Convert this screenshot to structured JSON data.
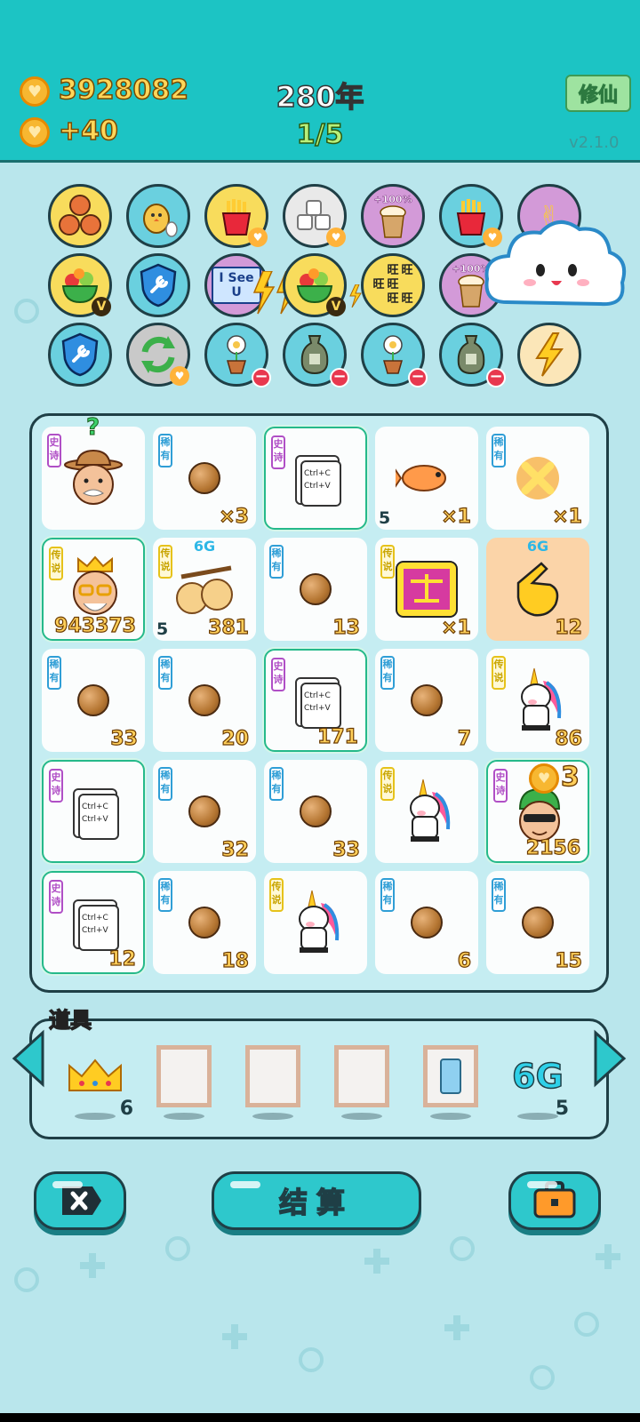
{
  "header": {
    "coins": "3928082",
    "income": "+40",
    "years": "280年",
    "progress": "1/5",
    "xiuxian_button": "修仙",
    "version": "v2.1.0"
  },
  "skills": {
    "row1": [
      "basketballs",
      "chick-egg",
      "fries-heart",
      "marshmallow-heart",
      "bubble-tea-100",
      "fries-heart",
      "rock-hand"
    ],
    "row2": [
      "fruit-bowl-v",
      "shield-wrench",
      "I See U",
      "fruit-bowl-v",
      "旺",
      "bubble-tea-100"
    ],
    "row3": [
      "shield-wrench",
      "refresh-heart",
      "plant-minus",
      "bag-minus",
      "plant-minus",
      "bag-minus",
      "lightning"
    ],
    "bubble_tea_text": "+100%",
    "isee_text": "I See U",
    "wang_text": "旺"
  },
  "grid": [
    {
      "tag": "史诗",
      "tagType": "epic",
      "item": "farmer-head",
      "badge": "?",
      "num": "",
      "left": "",
      "hl": false
    },
    {
      "tag": "稀有",
      "tagType": "rare",
      "item": "ball",
      "num": "×3",
      "left": "",
      "hl": false
    },
    {
      "tag": "史诗",
      "tagType": "epic",
      "item": "ctrl-cv",
      "num": "",
      "left": "",
      "hl": true
    },
    {
      "tag": "",
      "tagType": "",
      "item": "fish",
      "num": "×1",
      "left": "5",
      "hl": false
    },
    {
      "tag": "稀有",
      "tagType": "rare",
      "item": "burst-x",
      "num": "×1",
      "left": "",
      "hl": false
    },
    {
      "tag": "传说",
      "tagType": "legend",
      "item": "king-grandpa",
      "num": "943373",
      "left": "",
      "hl": true
    },
    {
      "tag": "传说",
      "tagType": "legend",
      "item": "double-balls",
      "top": "6G",
      "num": "381",
      "left": "5",
      "hl": false
    },
    {
      "tag": "稀有",
      "tagType": "rare",
      "item": "ball",
      "num": "13",
      "left": "",
      "hl": false
    },
    {
      "tag": "传说",
      "tagType": "legend",
      "item": "scale",
      "num": "×1",
      "left": "",
      "hl": false
    },
    {
      "tag": "",
      "tagType": "",
      "item": "pointing-hand",
      "top": "6G",
      "num": "12",
      "left": "",
      "hl": false,
      "orange": true
    },
    {
      "tag": "稀有",
      "tagType": "rare",
      "item": "ball",
      "num": "33",
      "left": "",
      "hl": false
    },
    {
      "tag": "稀有",
      "tagType": "rare",
      "item": "ball",
      "num": "20",
      "left": "",
      "hl": false
    },
    {
      "tag": "史诗",
      "tagType": "epic",
      "item": "ctrl-cv",
      "num": "171",
      "left": "",
      "hl": true
    },
    {
      "tag": "稀有",
      "tagType": "rare",
      "item": "ball",
      "num": "7",
      "left": "",
      "hl": false
    },
    {
      "tag": "传说",
      "tagType": "legend",
      "item": "unicorn",
      "num": "86",
      "left": "",
      "hl": false
    },
    {
      "tag": "史诗",
      "tagType": "epic",
      "item": "ctrl-cv",
      "num": "",
      "left": "",
      "hl": true
    },
    {
      "tag": "稀有",
      "tagType": "rare",
      "item": "ball",
      "num": "32",
      "left": "",
      "hl": false
    },
    {
      "tag": "稀有",
      "tagType": "rare",
      "item": "ball",
      "num": "33",
      "left": "",
      "hl": false
    },
    {
      "tag": "传说",
      "tagType": "legend",
      "item": "unicorn",
      "num": "",
      "left": "",
      "hl": false
    },
    {
      "tag": "史诗",
      "tagType": "epic",
      "item": "cool-guy",
      "top": "3",
      "num": "2156",
      "left": "",
      "hl": true
    },
    {
      "tag": "史诗",
      "tagType": "epic",
      "item": "ctrl-cv",
      "num": "12",
      "left": "",
      "hl": true
    },
    {
      "tag": "稀有",
      "tagType": "rare",
      "item": "ball",
      "num": "18",
      "left": "",
      "hl": false
    },
    {
      "tag": "传说",
      "tagType": "legend",
      "item": "unicorn",
      "num": "",
      "left": "",
      "hl": false
    },
    {
      "tag": "稀有",
      "tagType": "rare",
      "item": "ball",
      "num": "6",
      "left": "",
      "hl": false
    },
    {
      "tag": "稀有",
      "tagType": "rare",
      "item": "ball",
      "num": "15",
      "left": "",
      "hl": false
    }
  ],
  "ctrl_text": {
    "line1": "Ctrl+C",
    "line2": "Ctrl+V"
  },
  "props": {
    "title": "道具",
    "items": [
      {
        "name": "crown",
        "count": "6"
      },
      {
        "name": "frame",
        "count": ""
      },
      {
        "name": "frame",
        "count": ""
      },
      {
        "name": "frame",
        "count": ""
      },
      {
        "name": "fridge-frame",
        "count": ""
      },
      {
        "name": "6G",
        "count": "5"
      }
    ],
    "six_g_text": "6G"
  },
  "buttons": {
    "settle": "结算"
  },
  "colors": {
    "header": "#1cc4c4",
    "background": "#b9e6ec",
    "coin": "#f7b731",
    "epic": "#b04fc6",
    "rare": "#2f9ed6",
    "legend": "#e6c21a",
    "highlight": "#25b98a"
  }
}
